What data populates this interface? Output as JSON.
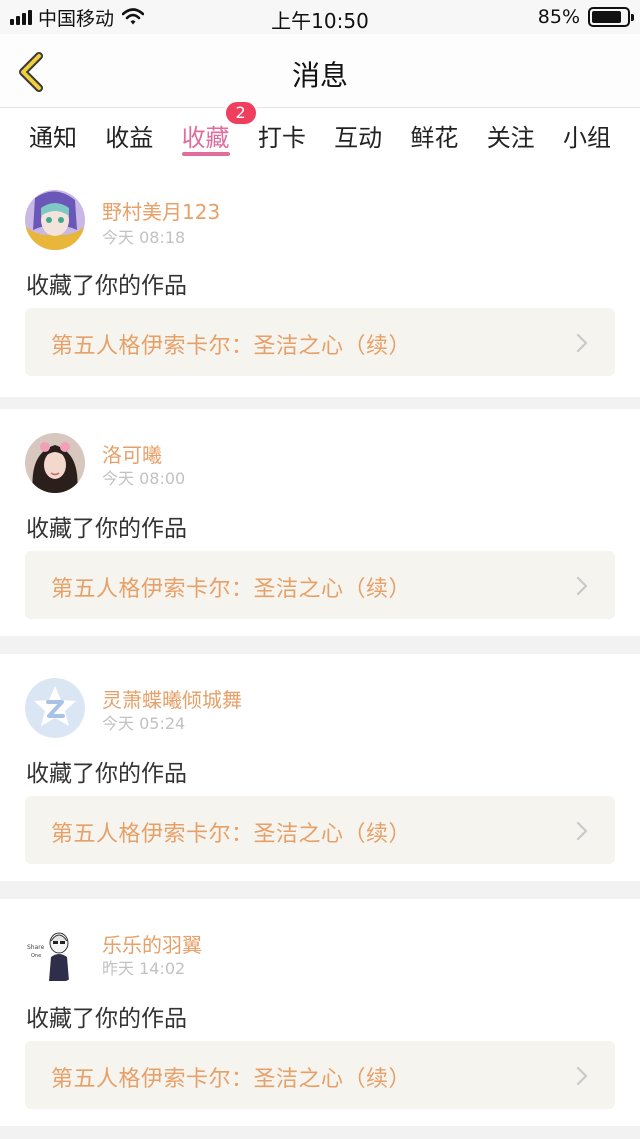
{
  "status_bar": {
    "carrier": "中国移动",
    "time": "上午10:50",
    "battery_percent": "85%",
    "battery_level": 0.85
  },
  "nav": {
    "title": "消息",
    "back_icon": "chevron-left-icon"
  },
  "colors": {
    "accent": "#e16d9d",
    "name": "#e7a068",
    "badge": "#f03f5e",
    "link_bg": "#f5f4ef"
  },
  "tabs": [
    {
      "label": "通知"
    },
    {
      "label": "收益"
    },
    {
      "label": "收藏",
      "active": true,
      "badge": "2"
    },
    {
      "label": "打卡"
    },
    {
      "label": "互动"
    },
    {
      "label": "鲜花"
    },
    {
      "label": "关注"
    },
    {
      "label": "小组"
    }
  ],
  "notifications": [
    {
      "username": "野村美月123",
      "time": "今天 08:18",
      "message": "收藏了你的作品",
      "work_title": "第五人格伊索卡尔：圣洁之心（续）",
      "avatar": "anime-avatar"
    },
    {
      "username": "洛可曦",
      "time": "今天 08:00",
      "message": "收藏了你的作品",
      "work_title": "第五人格伊索卡尔：圣洁之心（续）",
      "avatar": "photo-avatar"
    },
    {
      "username": "灵萧蝶曦倾城舞",
      "time": "今天 05:24",
      "message": "收藏了你的作品",
      "work_title": "第五人格伊索卡尔：圣洁之心（续）",
      "avatar": "default-z-avatar"
    },
    {
      "username": "乐乐的羽翼",
      "time": "昨天 14:02",
      "message": "收藏了你的作品",
      "work_title": "第五人格伊索卡尔：圣洁之心（续）",
      "avatar": "sketch-avatar"
    }
  ]
}
